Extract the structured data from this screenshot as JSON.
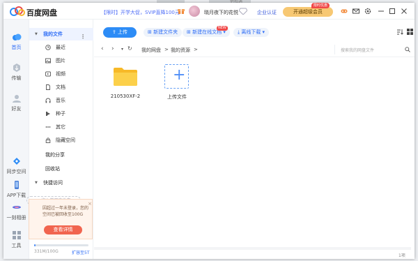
{
  "app": {
    "title": "百度网盘"
  },
  "background_fragments": {
    "text1": "他相遇"
  },
  "titlebar": {
    "promo": "【限时】开学大促，SVIP直降100元",
    "username": "晓月夜下的花悦",
    "enterprise": "企业认证",
    "upgrade": "开通超级会员",
    "upgrade_badge": "限时优惠",
    "icons": [
      "gift-icon",
      "game-icon",
      "mail-icon",
      "settings-icon",
      "minimize-icon",
      "maximize-icon",
      "close-icon"
    ]
  },
  "left_nav": [
    {
      "label": "首页",
      "icon": "home-icon"
    },
    {
      "label": "传输",
      "icon": "transfer-icon"
    },
    {
      "label": "好友",
      "icon": "friends-icon"
    },
    {
      "label": "同步空间",
      "icon": "sync-icon"
    },
    {
      "label": "APP下载",
      "icon": "phone-icon"
    },
    {
      "label": "一刻相册",
      "icon": "album-icon"
    },
    {
      "label": "工具",
      "icon": "tools-icon"
    }
  ],
  "sidebar": {
    "my_files": "我的文件",
    "items": [
      {
        "label": "最近",
        "icon": "clock-icon"
      },
      {
        "label": "图片",
        "icon": "image-icon"
      },
      {
        "label": "视频",
        "icon": "video-icon"
      },
      {
        "label": "文档",
        "icon": "document-icon"
      },
      {
        "label": "音乐",
        "icon": "music-icon"
      },
      {
        "label": "种子",
        "icon": "torrent-icon"
      },
      {
        "label": "其它",
        "icon": "more-icon"
      },
      {
        "label": "隐藏空间",
        "icon": "lock-icon"
      }
    ],
    "my_share": "我的分享",
    "recycle": "回收站",
    "quick_access": "快捷访问",
    "add_quick": "+ 拖入常用文件夹"
  },
  "notice": {
    "text": "因超过一年未登录，您的空间已被回收至100G",
    "button": "查看详情"
  },
  "storage": {
    "text": "331M/100G",
    "expand": "扩容至5T",
    "used_fraction": 0.0032
  },
  "toolbar": {
    "upload": "上传",
    "new_folder": "新建文件夹",
    "new_online_doc": "新建在线文档",
    "new_badge": "NEW",
    "offline_download": "离线下载"
  },
  "path": {
    "crumbs": [
      "我的网盘",
      "我的资源"
    ],
    "search_placeholder": "搜索我的网盘文件"
  },
  "files": [
    {
      "name": "210530XF-2",
      "type": "folder"
    },
    {
      "name": "上传文件",
      "type": "upload"
    }
  ],
  "status": {
    "count": "1项"
  },
  "colors": {
    "accent": "#2d8cf6",
    "folder": "#f9c940",
    "upgrade": "#f7c873",
    "notice_button": "#f1654f"
  }
}
